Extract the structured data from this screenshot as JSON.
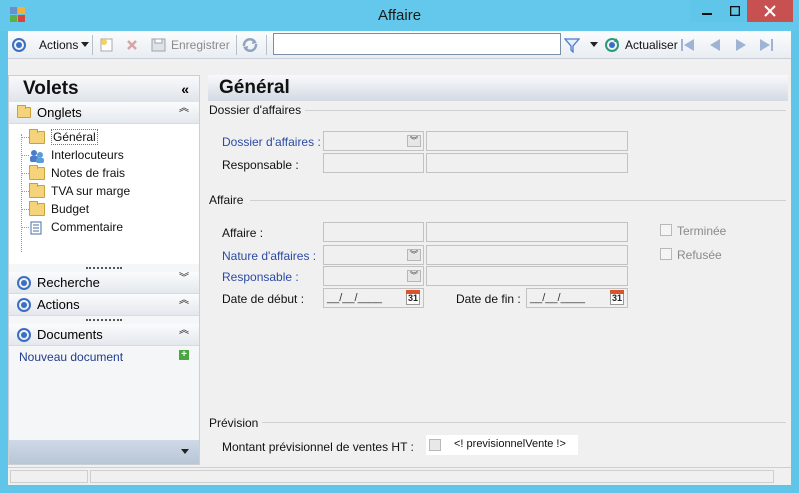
{
  "window": {
    "title": "Affaire"
  },
  "toolbar": {
    "actions_label": "Actions",
    "save_label": "Enregistrer",
    "refresh_label": "Actualiser",
    "search_value": ""
  },
  "left_panel": {
    "title": "Volets",
    "sections": {
      "onglets": "Onglets",
      "recherche": "Recherche",
      "actions": "Actions",
      "documents": "Documents"
    },
    "tree": [
      {
        "label": "Général",
        "icon": "folder-open-icon",
        "selected": true
      },
      {
        "label": "Interlocuteurs",
        "icon": "contacts-icon",
        "selected": false
      },
      {
        "label": "Notes de frais",
        "icon": "folder-icon",
        "selected": false
      },
      {
        "label": "TVA sur marge",
        "icon": "folder-icon",
        "selected": false
      },
      {
        "label": "Budget",
        "icon": "folder-icon",
        "selected": false
      },
      {
        "label": "Commentaire",
        "icon": "document-icon",
        "selected": false
      }
    ],
    "new_document": "Nouveau document"
  },
  "main": {
    "title": "Général",
    "groups": {
      "dossier": "Dossier d'affaires",
      "affaire": "Affaire",
      "prevision": "Prévision"
    },
    "fields": {
      "dossier_affaires": "Dossier d'affaires :",
      "responsable_1": "Responsable :",
      "affaire": "Affaire :",
      "nature_affaires": "Nature d'affaires :",
      "responsable_2": "Responsable :",
      "date_debut": "Date de début :",
      "date_fin": "Date de fin :",
      "date_placeholder": "__/__/____",
      "calendar_day": "31",
      "terminee": "Terminée",
      "refusee": "Refusée",
      "montant": "Montant prévisionnel de ventes HT :",
      "montant_value": "<! previsionnelVente !>"
    }
  },
  "colors": {
    "title_bar": "#64c8ec",
    "close_button": "#c75050",
    "link": "#2c4aa5",
    "accent_blue": "#3b6fc4"
  }
}
